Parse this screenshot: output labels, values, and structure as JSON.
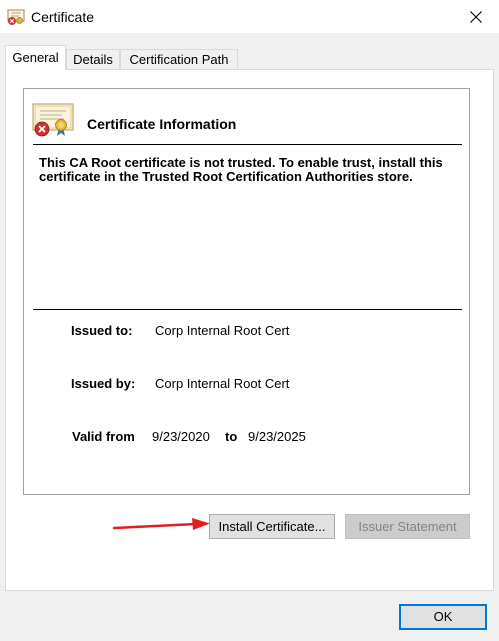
{
  "window": {
    "title": "Certificate",
    "close_glyph": "✕"
  },
  "tabs": [
    {
      "label": "General",
      "active": true
    },
    {
      "label": "Details",
      "active": false
    },
    {
      "label": "Certification Path",
      "active": false
    }
  ],
  "general": {
    "heading": "Certificate Information",
    "warning": "This CA Root certificate is not trusted. To enable trust, install this certificate in the Trusted Root Certification Authorities store.",
    "issued_to_label": "Issued to:",
    "issued_to_value": "Corp Internal Root Cert",
    "issued_by_label": "Issued by:",
    "issued_by_value": "Corp Internal Root Cert",
    "valid_from_label": "Valid from",
    "valid_from_value": "9/23/2020",
    "valid_to_label": "to",
    "valid_to_value": "9/23/2025"
  },
  "buttons": {
    "install": "Install Certificate...",
    "issuer_statement": "Issuer Statement",
    "ok": "OK"
  },
  "icons": {
    "title": "certificate-error-icon",
    "cert": "certificate-untrusted-icon",
    "close": "close-icon",
    "annotation": "red-arrow"
  },
  "colors": {
    "accent": "#0078d7",
    "annotation_arrow": "#e02020",
    "error_badge": "#d32f2f"
  }
}
